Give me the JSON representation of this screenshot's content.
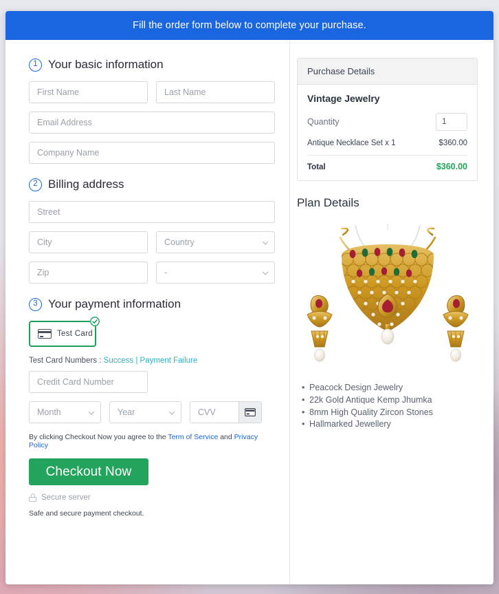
{
  "banner": {
    "message": "Fill the order form below to complete your purchase."
  },
  "form": {
    "steps": [
      {
        "number": "1",
        "title": "Your basic information"
      },
      {
        "number": "2",
        "title": "Billing address"
      },
      {
        "number": "3",
        "title": "Your payment information"
      }
    ],
    "basic_info": {
      "first_name_placeholder": "First Name",
      "first_name_value": "",
      "last_name_placeholder": "Last Name",
      "last_name_value": "",
      "email_placeholder": "Email Address",
      "email_value": "",
      "company_placeholder": "Company Name",
      "company_value": ""
    },
    "billing": {
      "street_placeholder": "Street",
      "street_value": "",
      "city_placeholder": "City",
      "city_value": "",
      "country_placeholder": "Country",
      "country_value": "",
      "zip_placeholder": "Zip",
      "zip_value": "",
      "state_placeholder": "-",
      "state_value": ""
    },
    "payment": {
      "card_tile_label": "Test Card",
      "card_tile_selected": true,
      "test_card_prefix": "Test Card Numbers :",
      "test_card_success": "Success",
      "test_card_separator": "|",
      "test_card_failure": "Payment Failure",
      "card_number_placeholder": "Credit Card Number",
      "card_number_value": "",
      "month_placeholder": "Month",
      "month_value": "",
      "year_placeholder": "Year",
      "year_value": "",
      "cvv_placeholder": "CVV",
      "cvv_value": ""
    },
    "terms": {
      "prefix": "By clicking Checkout Now you agree to the",
      "tos_link": "Term of Service",
      "conjunction": "and",
      "privacy_link": "Privacy Policy"
    },
    "checkout_button": "Checkout Now",
    "secure_server": "Secure server",
    "safe_note": "Safe and secure payment checkout."
  },
  "purchase_details": {
    "header": "Purchase Details",
    "product_name": "Vintage Jewelry",
    "quantity_label": "Quantity",
    "quantity_value": "1",
    "line_item_label": "Antique Necklace Set x 1",
    "line_item_price": "$360.00",
    "total_label": "Total",
    "total_price": "$360.00"
  },
  "plan_details": {
    "title": "Plan Details",
    "image_alt": "Antique gold necklace set with matching jhumka earrings",
    "features": [
      "Peacock Design Jewelry",
      "22k Gold Antique Kemp Jhumka",
      "8mm High Quality Zircon Stones",
      "Hallmarked Jewellery"
    ]
  },
  "colors": {
    "banner_blue": "#1a66e0",
    "accent_blue": "#1a66e0",
    "success_green": "#23a45d",
    "tile_green": "#1aa05a",
    "link_teal": "#2bb3c6",
    "gold": "#d4a017"
  }
}
